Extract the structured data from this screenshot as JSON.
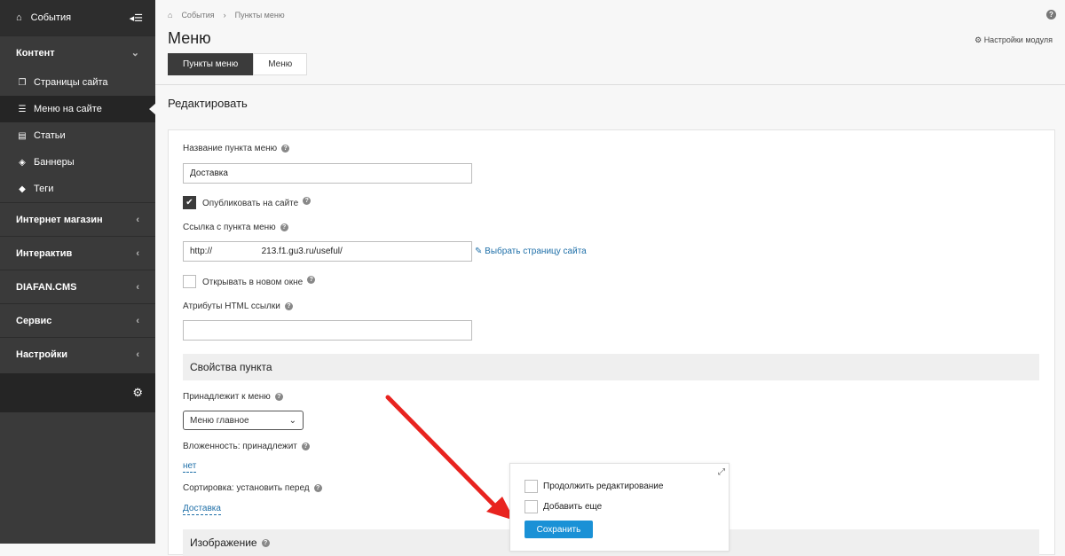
{
  "sidebar": {
    "events_label": "События",
    "collapse_icon": "collapse-menu-icon",
    "sections": [
      {
        "label": "Контент",
        "expanded": true
      },
      {
        "label": "Интернет магазин"
      },
      {
        "label": "Интерактив"
      },
      {
        "label": "DIAFAN.CMS"
      },
      {
        "label": "Сервис"
      },
      {
        "label": "Настройки"
      }
    ],
    "content_items": [
      {
        "label": "Страницы сайта",
        "icon": "pages-icon"
      },
      {
        "label": "Меню на сайте",
        "icon": "menu-list-icon",
        "active": true
      },
      {
        "label": "Статьи",
        "icon": "article-icon"
      },
      {
        "label": "Баннеры",
        "icon": "banner-icon"
      },
      {
        "label": "Теги",
        "icon": "tag-icon"
      }
    ]
  },
  "breadcrumb": {
    "home": "События",
    "current": "Пункты меню"
  },
  "page": {
    "title": "Меню",
    "module_settings": "Настройки модуля"
  },
  "tabs": [
    {
      "label": "Пункты меню",
      "active": true
    },
    {
      "label": "Меню"
    }
  ],
  "section_title": "Редактировать",
  "form": {
    "name_label": "Название пункта меню",
    "name_value": "Доставка",
    "publish_label": "Опубликовать на сайте",
    "publish_checked": true,
    "link_label": "Ссылка с пункта меню",
    "link_value": "http://                    213.f1.gu3.ru/useful/",
    "pick_page": "Выбрать страницу сайта",
    "new_window_label": "Открывать в новом окне",
    "attrs_label": "Атрибуты HTML ссылки",
    "attrs_value": "",
    "props_section": "Свойства пункта",
    "belongs_label": "Принадлежит к меню",
    "belongs_value": "Меню главное",
    "nesting_label": "Вложенность: принадлежит",
    "nesting_value": "нет",
    "sort_label": "Сортировка: установить перед",
    "sort_value": "Доставка",
    "image_section": "Изображение"
  },
  "save_panel": {
    "continue_label": "Продолжить редактирование",
    "add_more_label": "Добавить еще",
    "save_label": "Сохранить"
  },
  "colors": {
    "accent": "#1a91d6",
    "sidebar": "#3a3a3a",
    "annotation_arrow": "#e8231f"
  }
}
